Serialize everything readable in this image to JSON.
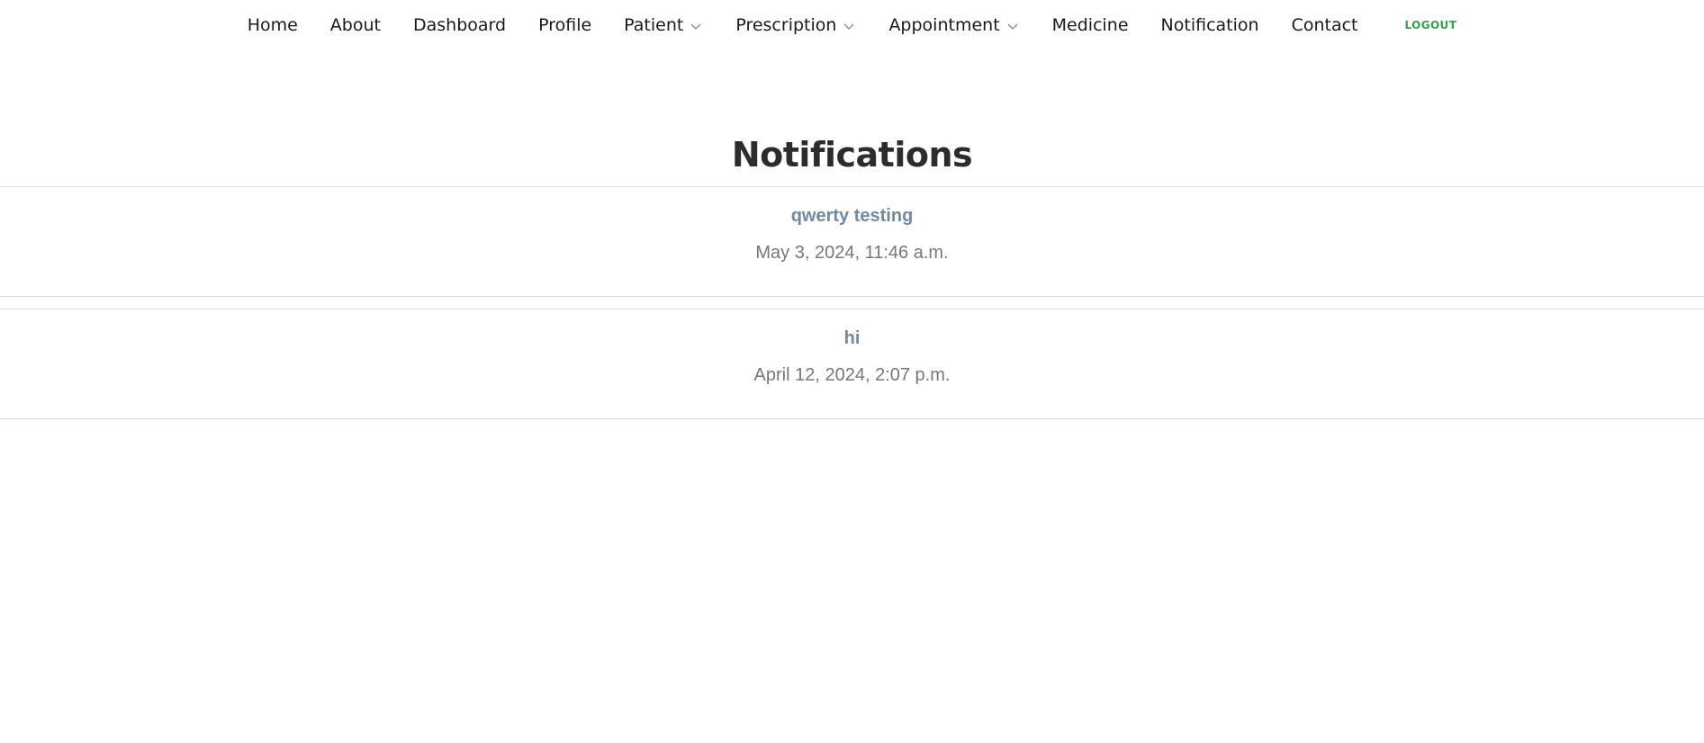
{
  "nav": {
    "items": [
      {
        "label": "Home"
      },
      {
        "label": "About"
      },
      {
        "label": "Dashboard"
      },
      {
        "label": "Profile"
      },
      {
        "label": "Patient",
        "icon": "chevron-down-icon"
      },
      {
        "label": "Prescription",
        "icon": "chevron-down-icon"
      },
      {
        "label": "Appointment",
        "icon": "chevron-down-icon"
      },
      {
        "label": "Medicine"
      },
      {
        "label": "Notification"
      },
      {
        "label": "Contact"
      }
    ],
    "logout_label": "LOGOUT",
    "logout_color": "#35a04a"
  },
  "page": {
    "title": "Notifications"
  },
  "notifications": [
    {
      "title": "qwerty testing",
      "time": "May 3, 2024, 11:46 a.m."
    },
    {
      "title": "hi",
      "time": "April 12, 2024, 2:07 p.m."
    }
  ],
  "colors": {
    "notification_title": "#7288a3",
    "notification_time": "#777777"
  }
}
